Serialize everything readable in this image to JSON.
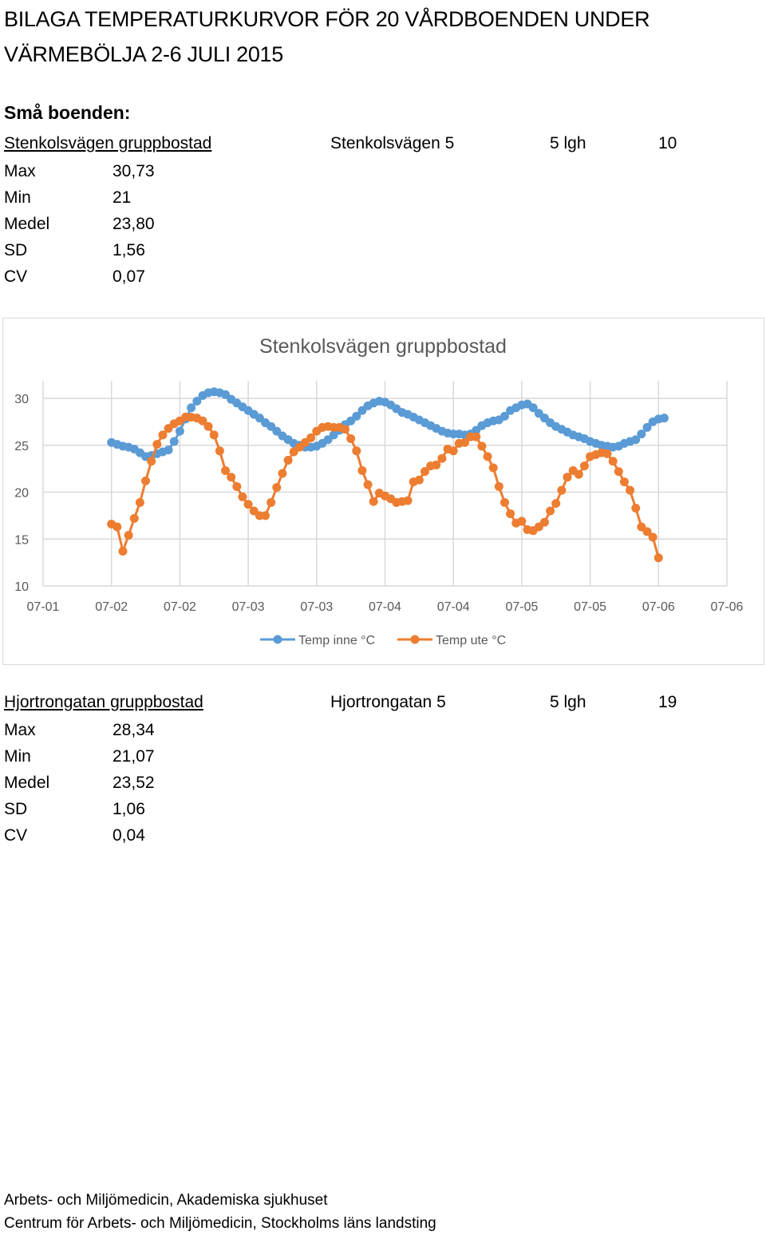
{
  "document": {
    "title": "BILAGA TEMPERATURKURVOR FÖR 20 VÅRDBOENDEN UNDER VÄRMEBÖLJA 2-6 JULI 2015",
    "section_heading": "Små boenden:",
    "facilities": [
      {
        "name": "Stenkolsvägen gruppbostad",
        "address": "Stenkolsvägen 5",
        "units": "5 lgh",
        "number": "10",
        "stats": [
          {
            "label": "Max",
            "value": "30,73"
          },
          {
            "label": "Min",
            "value": "21"
          },
          {
            "label": "Medel",
            "value": "23,80"
          },
          {
            "label": "SD",
            "value": "1,56"
          },
          {
            "label": "CV",
            "value": "0,07"
          }
        ]
      },
      {
        "name": "Hjortrongatan gruppbostad",
        "address": "Hjortrongatan 5",
        "units": "5 lgh",
        "number": "19",
        "stats": [
          {
            "label": "Max",
            "value": "28,34"
          },
          {
            "label": "Min",
            "value": "21,07"
          },
          {
            "label": "Medel",
            "value": "23,52"
          },
          {
            "label": "SD",
            "value": "1,06"
          },
          {
            "label": "CV",
            "value": "0,04"
          }
        ]
      }
    ],
    "footer": [
      "Arbets- och Miljömedicin, Akademiska sjukhuset",
      "Centrum för Arbets- och Miljömedicin, Stockholms läns landsting"
    ]
  },
  "chart_data": {
    "type": "line",
    "title": "Stenkolsvägen gruppbostad",
    "xlabel": "",
    "ylabel": "",
    "categories": [
      "07-01",
      "07-02",
      "07-02",
      "07-03",
      "07-03",
      "07-04",
      "07-04",
      "07-05",
      "07-05",
      "07-06",
      "07-06"
    ],
    "x_note": "Approximately hourly readings starting at second category tick (07-02) and ending at 07-06; 12 readings per tick interval",
    "ylim": [
      10,
      30
    ],
    "yticks": [
      10,
      15,
      20,
      25,
      30
    ],
    "grid": true,
    "legend_position": "bottom",
    "series": [
      {
        "name": "Temp inne °C",
        "color": "#5B9BD5",
        "values": [
          25.3,
          25.1,
          24.9,
          24.8,
          24.6,
          24.2,
          23.8,
          23.9,
          24.1,
          24.3,
          24.5,
          25.4,
          26.5,
          27.8,
          29.0,
          29.7,
          30.3,
          30.6,
          30.7,
          30.6,
          30.4,
          29.9,
          29.5,
          29.1,
          28.7,
          28.3,
          27.9,
          27.4,
          27.0,
          26.5,
          26.0,
          25.6,
          25.2,
          25.0,
          24.8,
          24.8,
          24.9,
          25.2,
          25.6,
          26.1,
          26.6,
          27.2,
          27.6,
          28.1,
          28.7,
          29.2,
          29.5,
          29.7,
          29.6,
          29.3,
          28.9,
          28.5,
          28.3,
          28.0,
          27.7,
          27.4,
          27.1,
          26.8,
          26.5,
          26.3,
          26.2,
          26.2,
          26.1,
          26.2,
          26.6,
          27.1,
          27.4,
          27.6,
          27.7,
          28.1,
          28.7,
          29.0,
          29.3,
          29.4,
          29.0,
          28.4,
          27.9,
          27.4,
          27.0,
          26.7,
          26.4,
          26.1,
          25.9,
          25.7,
          25.4,
          25.2,
          25.0,
          24.9,
          24.8,
          24.9,
          25.2,
          25.4,
          25.6,
          26.2,
          26.9,
          27.5,
          27.8,
          27.9
        ]
      },
      {
        "name": "Temp ute °C",
        "color": "#ED7D31",
        "values": [
          16.6,
          16.3,
          13.7,
          15.4,
          17.2,
          18.9,
          21.2,
          23.3,
          25.1,
          26.1,
          26.8,
          27.3,
          27.6,
          28.0,
          28.0,
          27.9,
          27.6,
          27.0,
          26.1,
          24.4,
          22.3,
          21.6,
          20.6,
          19.5,
          18.7,
          18.0,
          17.5,
          17.5,
          18.9,
          20.5,
          22.0,
          23.4,
          24.3,
          24.8,
          25.3,
          25.8,
          26.5,
          26.9,
          27.0,
          26.9,
          26.9,
          26.7,
          25.7,
          24.4,
          22.3,
          20.8,
          19.0,
          19.9,
          19.6,
          19.3,
          18.9,
          19.0,
          19.1,
          21.1,
          21.3,
          22.2,
          22.8,
          22.9,
          23.6,
          24.6,
          24.4,
          25.2,
          25.3,
          25.9,
          25.9,
          24.9,
          23.8,
          22.6,
          20.6,
          18.9,
          17.7,
          16.7,
          16.9,
          16.0,
          15.9,
          16.3,
          16.8,
          18.0,
          18.8,
          20.2,
          21.6,
          22.3,
          21.9,
          22.8,
          23.8,
          24.0,
          24.2,
          24.1,
          23.3,
          22.2,
          21.1,
          20.2,
          18.3,
          16.3,
          15.8,
          15.2,
          13.0
        ]
      }
    ]
  }
}
